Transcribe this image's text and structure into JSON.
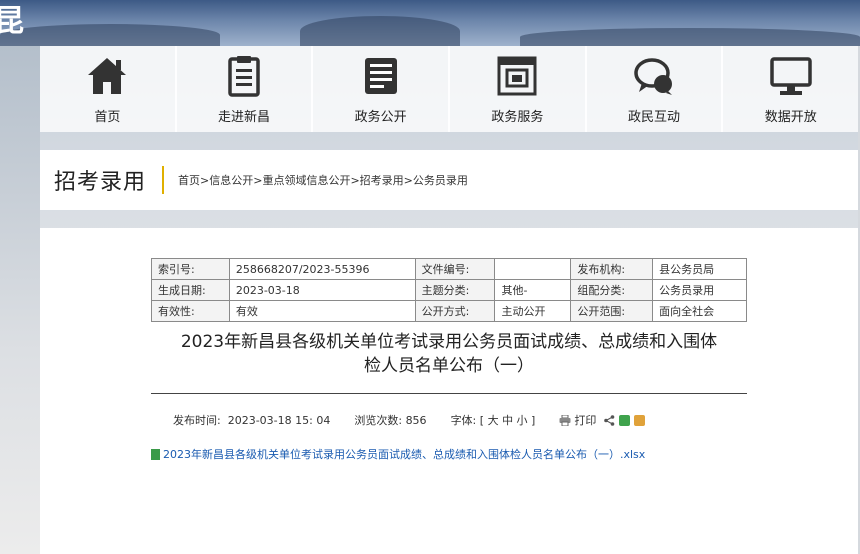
{
  "logo_fragment": "昆",
  "nav": {
    "items": [
      {
        "label": "首页",
        "icon": "home-icon"
      },
      {
        "label": "走进新昌",
        "icon": "document-list-icon"
      },
      {
        "label": "政务公开",
        "icon": "news-icon"
      },
      {
        "label": "政务服务",
        "icon": "window-service-icon"
      },
      {
        "label": "政民互动",
        "icon": "chat-bubble-icon"
      },
      {
        "label": "数据开放",
        "icon": "monitor-icon"
      }
    ]
  },
  "section": {
    "title": "招考录用",
    "breadcrumb": [
      "首页",
      ">",
      "信息公开",
      ">",
      "重点领域信息公开",
      ">",
      "招考录用",
      ">",
      "公务员录用"
    ]
  },
  "meta": {
    "row1": {
      "k1": "索引号:",
      "v1": "258668207/2023-55396",
      "k2": "文件编号:",
      "v2": "",
      "k3": "发布机构:",
      "v3": "县公务员局"
    },
    "row2": {
      "k1": "生成日期:",
      "v1": "2023-03-18",
      "k2": "主题分类:",
      "v2": "其他-",
      "k3": "组配分类:",
      "v3": "公务员录用"
    },
    "row3": {
      "k1": "有效性:",
      "v1": "有效",
      "k2": "公开方式:",
      "v2": "主动公开",
      "k3": "公开范围:",
      "v3": "面向全社会"
    }
  },
  "article": {
    "title_line1": "2023年新昌县各级机关单位考试录用公务员面试成绩、总成绩和入围体",
    "title_line2": "检人员名单公布（一）",
    "publish_label": "发布时间:",
    "publish_time": "2023-03-18 15: 04",
    "views_label": "浏览次数:",
    "views": "856",
    "font_label": "字体:",
    "font_options": "[ 大 中 小 ]",
    "print_label": "打印",
    "attachment": "2023年新昌县各级机关单位考试录用公务员面试成绩、总成绩和入围体检人员名单公布（一）.xlsx"
  },
  "colors": {
    "accent_separator": "#e0b000",
    "link": "#1a5bb0"
  }
}
